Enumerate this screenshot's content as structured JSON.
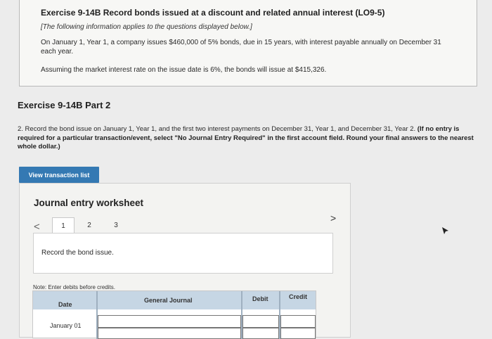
{
  "exercise": {
    "title": "Exercise 9-14B Record bonds issued at a discount and related annual interest (LO9-5)",
    "note": "[The following information applies to the questions displayed below.]",
    "para1": "On January 1, Year 1, a company issues $460,000 of 5% bonds, due in 15 years, with interest payable annually on December 31 each year.",
    "para2": "Assuming the market interest rate on the issue date is 6%, the bonds will issue at $415,326."
  },
  "part": {
    "title": "Exercise 9-14B Part 2",
    "question_prefix": "2. Record the bond issue on January 1, Year 1, and the first two interest payments on December 31, Year 1, and December 31, Year 2.",
    "question_bold": "(If no entry is required for a particular transaction/event, select \"No Journal Entry Required\" in the first account field. Round your final answers to the nearest whole dollar.)"
  },
  "view_button_label": "View transaction list",
  "worksheet": {
    "title": "Journal entry worksheet",
    "prev_symbol": "<",
    "next_symbol": ">",
    "tabs": [
      "1",
      "2",
      "3"
    ],
    "active_tab": "1",
    "instruction": "Record the bond issue.",
    "note": "Note: Enter debits before credits.",
    "columns": {
      "date": "Date",
      "account": "General Journal",
      "debit": "Debit",
      "credit": "Credit"
    },
    "rows": [
      {
        "date": "January 01",
        "account": "",
        "debit": "",
        "credit": ""
      }
    ]
  },
  "colors": {
    "button": "#3479b3",
    "table_header": "#c6d6e4",
    "background": "#ececec"
  }
}
